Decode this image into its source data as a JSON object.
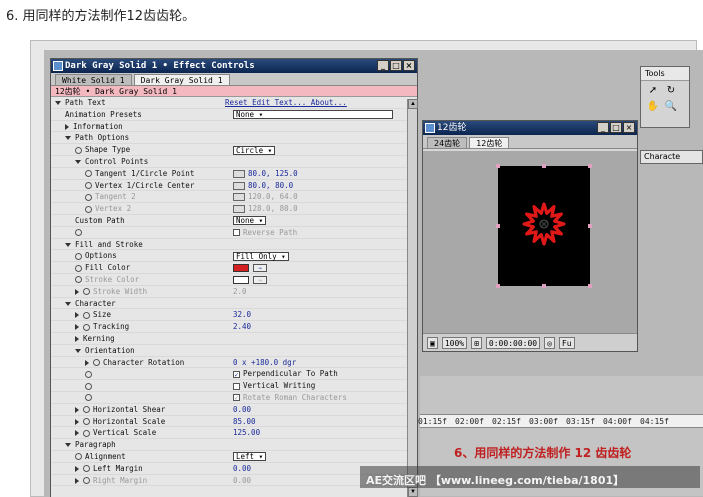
{
  "heading": "6. 用同样的方法制作12齿齿轮。",
  "effect_controls": {
    "title": "Dark Gray Solid 1 • Effect Controls",
    "tabs": [
      "White Solid 1",
      "Dark Gray Solid 1"
    ],
    "layer": "12齿轮 • Dark Gray Solid 1",
    "rows": [
      {
        "indent": 0,
        "tri": "d",
        "clock": false,
        "label": "Path Text",
        "value": "Reset Edit Text... About...",
        "kind": "link"
      },
      {
        "indent": 1,
        "tri": "",
        "clock": false,
        "label": "Animation Presets",
        "value": "None",
        "kind": "dropdown"
      },
      {
        "indent": 1,
        "tri": "r",
        "clock": false,
        "label": "Information",
        "value": "",
        "kind": ""
      },
      {
        "indent": 1,
        "tri": "d",
        "clock": false,
        "label": "Path Options",
        "value": "",
        "kind": ""
      },
      {
        "indent": 2,
        "tri": "",
        "clock": true,
        "label": "Shape Type",
        "value": "Circle",
        "kind": "dropdown"
      },
      {
        "indent": 2,
        "tri": "d",
        "clock": false,
        "label": "Control Points",
        "value": "",
        "kind": ""
      },
      {
        "indent": 3,
        "tri": "",
        "clock": true,
        "label": "Tangent 1/Circle Point",
        "value": "80.0, 125.0",
        "kind": "point"
      },
      {
        "indent": 3,
        "tri": "",
        "clock": true,
        "label": "Vertex 1/Circle Center",
        "value": "80.0, 80.0",
        "kind": "point"
      },
      {
        "indent": 3,
        "tri": "",
        "clock": true,
        "label": "Tangent 2",
        "value": "120.0, 64.0",
        "kind": "point",
        "dim": true
      },
      {
        "indent": 3,
        "tri": "",
        "clock": true,
        "label": "Vertex 2",
        "value": "128.0, 80.0",
        "kind": "point",
        "dim": true
      },
      {
        "indent": 2,
        "tri": "",
        "clock": false,
        "label": "Custom Path",
        "value": "None",
        "kind": "dropdown"
      },
      {
        "indent": 2,
        "tri": "",
        "clock": true,
        "label": "",
        "value": "Reverse Path",
        "kind": "check",
        "dim": true
      },
      {
        "indent": 1,
        "tri": "d",
        "clock": false,
        "label": "Fill and Stroke",
        "value": "",
        "kind": ""
      },
      {
        "indent": 2,
        "tri": "",
        "clock": true,
        "label": "Options",
        "value": "Fill Only",
        "kind": "dropdown"
      },
      {
        "indent": 2,
        "tri": "",
        "clock": true,
        "label": "Fill Color",
        "value": "",
        "kind": "color",
        "color": "#d42020"
      },
      {
        "indent": 2,
        "tri": "",
        "clock": true,
        "label": "Stroke Color",
        "value": "",
        "kind": "color",
        "color": "#ffffff",
        "dim": true
      },
      {
        "indent": 2,
        "tri": "r",
        "clock": true,
        "label": "Stroke Width",
        "value": "2.0",
        "kind": "num",
        "dim": true
      },
      {
        "indent": 1,
        "tri": "d",
        "clock": false,
        "label": "Character",
        "value": "",
        "kind": ""
      },
      {
        "indent": 2,
        "tri": "r",
        "clock": true,
        "label": "Size",
        "value": "32.0",
        "kind": "num"
      },
      {
        "indent": 2,
        "tri": "r",
        "clock": true,
        "label": "Tracking",
        "value": "2.40",
        "kind": "num"
      },
      {
        "indent": 2,
        "tri": "r",
        "clock": false,
        "label": "Kerning",
        "value": "",
        "kind": ""
      },
      {
        "indent": 2,
        "tri": "d",
        "clock": false,
        "label": "Orientation",
        "value": "",
        "kind": ""
      },
      {
        "indent": 3,
        "tri": "r",
        "clock": true,
        "label": "Character Rotation",
        "value": "0 x +180.0 dgr",
        "kind": "num"
      },
      {
        "indent": 3,
        "tri": "",
        "clock": true,
        "label": "",
        "value": "Perpendicular To Path",
        "kind": "checked"
      },
      {
        "indent": 3,
        "tri": "",
        "clock": true,
        "label": "",
        "value": "Vertical Writing",
        "kind": "check"
      },
      {
        "indent": 3,
        "tri": "",
        "clock": true,
        "label": "",
        "value": "Rotate Roman Characters",
        "kind": "checked",
        "dim": true
      },
      {
        "indent": 2,
        "tri": "r",
        "clock": true,
        "label": "Horizontal Shear",
        "value": "0.00",
        "kind": "num"
      },
      {
        "indent": 2,
        "tri": "r",
        "clock": true,
        "label": "Horizontal Scale",
        "value": "85.00",
        "kind": "num"
      },
      {
        "indent": 2,
        "tri": "r",
        "clock": true,
        "label": "Vertical Scale",
        "value": "125.00",
        "kind": "num"
      },
      {
        "indent": 1,
        "tri": "d",
        "clock": false,
        "label": "Paragraph",
        "value": "",
        "kind": ""
      },
      {
        "indent": 2,
        "tri": "",
        "clock": true,
        "label": "Alignment",
        "value": "Left",
        "kind": "dropdown"
      },
      {
        "indent": 2,
        "tri": "r",
        "clock": true,
        "label": "Left Margin",
        "value": "0.00",
        "kind": "num"
      },
      {
        "indent": 2,
        "tri": "r",
        "clock": true,
        "label": "Right Margin",
        "value": "0.00",
        "kind": "num",
        "dim": true
      }
    ]
  },
  "comp": {
    "title": "12齿轮",
    "tabs": [
      "24齿轮",
      "12齿轮"
    ],
    "zoom": "100%",
    "timecode": "0:00:00:00",
    "quality": "Fu"
  },
  "tools": {
    "title": "Tools",
    "icons": [
      "arrow-icon",
      "rotate-icon",
      "hand-icon",
      "zoom-icon"
    ]
  },
  "character_panel": "Characte",
  "timeline": {
    "ruler": [
      "01:15f",
      "02:00f",
      "02:15f",
      "03:00f",
      "03:15f",
      "04:00f",
      "04:15f"
    ],
    "caption": "6、用同样的方法制作 12 齿齿轮",
    "watermark": "AE交流区吧 【www.lineeg.com/tieba/1801】"
  },
  "colors": {
    "gear": "#e01818",
    "title_bar": "#0c2550",
    "layer_bar": "#f4b8c0"
  }
}
